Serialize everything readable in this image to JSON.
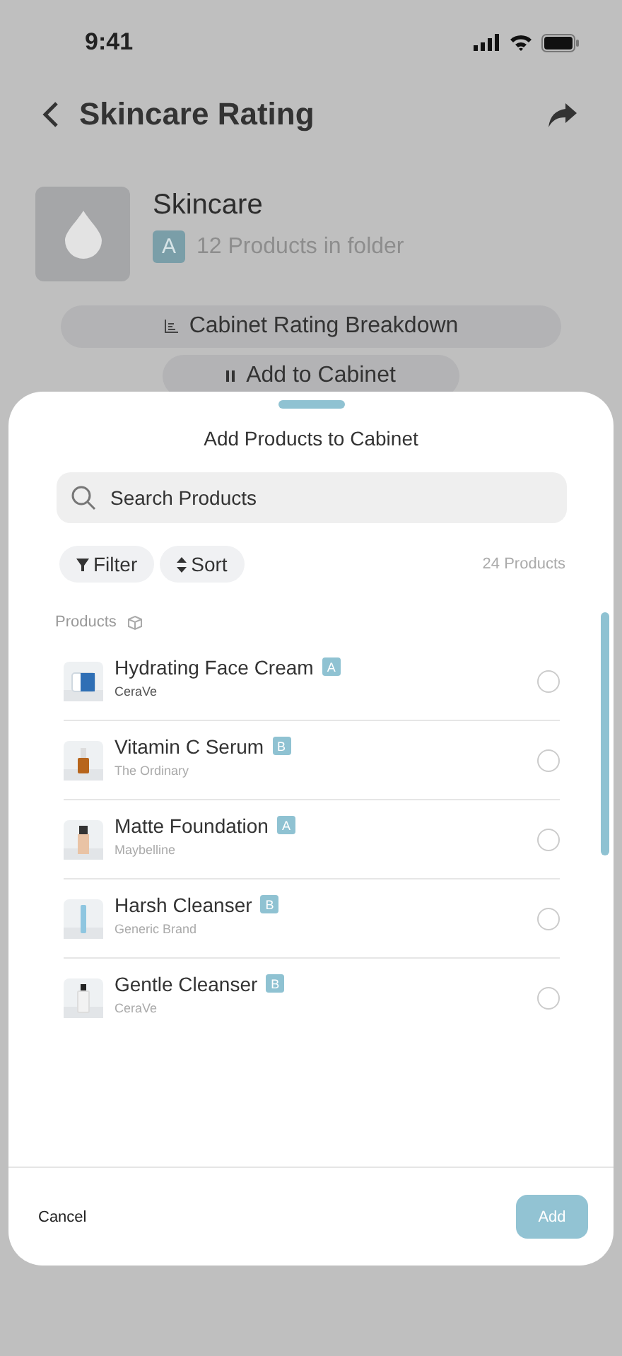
{
  "status_bar": {
    "time": "9:41"
  },
  "header": {
    "title": "Skincare Rating"
  },
  "folder": {
    "name": "Skincare",
    "grade": "A",
    "count": "12 Products in folder"
  },
  "actions": [
    "Cabinet Rating Breakdown",
    "Add to Cabinet"
  ],
  "sheet": {
    "title": "Add Products to Cabinet",
    "search": {
      "placeholder": "Search Products"
    },
    "filters": [
      {
        "kind": "filter",
        "label": "Filter"
      },
      {
        "kind": "sort",
        "label": "Sort"
      }
    ],
    "count": "24 Products",
    "section": "Products",
    "products": [
      {
        "name": "Hydrating Face Cream",
        "grade": "A",
        "brand": "CeraVe",
        "brand_dark": true,
        "selected": false
      },
      {
        "name": "Vitamin C Serum",
        "grade": "B",
        "brand": "The Ordinary",
        "brand_dark": false,
        "selected": false
      },
      {
        "name": "Matte Foundation",
        "grade": "A",
        "brand": "Maybelline",
        "brand_dark": false,
        "selected": false
      },
      {
        "name": "Harsh Cleanser",
        "grade": "B",
        "brand": "Generic Brand",
        "brand_dark": false,
        "selected": false
      },
      {
        "name": "Gentle Cleanser",
        "grade": "B",
        "brand": "CeraVe",
        "brand_dark": false,
        "selected": false
      }
    ],
    "cancel": "Cancel",
    "add": {
      "label": "Add",
      "disabled": true
    }
  }
}
